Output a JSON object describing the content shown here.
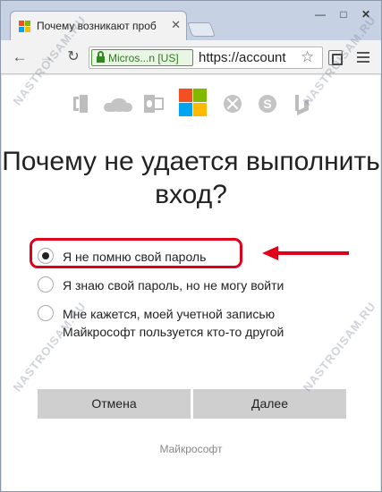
{
  "browser": {
    "tab": {
      "title": "Почему возникают проб",
      "favicon": "microsoft-favicon"
    },
    "window_controls": {
      "minimize": "—",
      "maximize": "□",
      "close": "✕"
    },
    "toolbar": {
      "back": "←",
      "forward": "→",
      "reload": "↻",
      "ev_badge": "Micros...n [US]",
      "url": "https://account",
      "star": "☆",
      "menu": "menu-icon"
    }
  },
  "page": {
    "product_icons": [
      "office-icon",
      "onedrive-icon",
      "outlook-icon",
      "microsoft-logo",
      "xbox-icon",
      "skype-icon",
      "bing-icon"
    ],
    "heading": "Почему не удается выполнить вход?",
    "options": [
      {
        "label": "Я не помню свой пароль",
        "checked": true
      },
      {
        "label": "Я знаю свой пароль, но не могу войти",
        "checked": false
      },
      {
        "label": "Мне кажется, моей учетной записью Майкрософт пользуется кто-то другой",
        "checked": false
      }
    ],
    "buttons": {
      "cancel": "Отмена",
      "next": "Далее"
    },
    "footer": "Майкрософт"
  },
  "annotation": {
    "color": "#e0001a"
  },
  "watermark": "NASTROISAM.RU",
  "colors": {
    "ms_red": "#f25022",
    "ms_green": "#7fba00",
    "ms_blue": "#00a4ef",
    "ms_yellow": "#ffb900",
    "ev_green": "#2f8a1e"
  }
}
